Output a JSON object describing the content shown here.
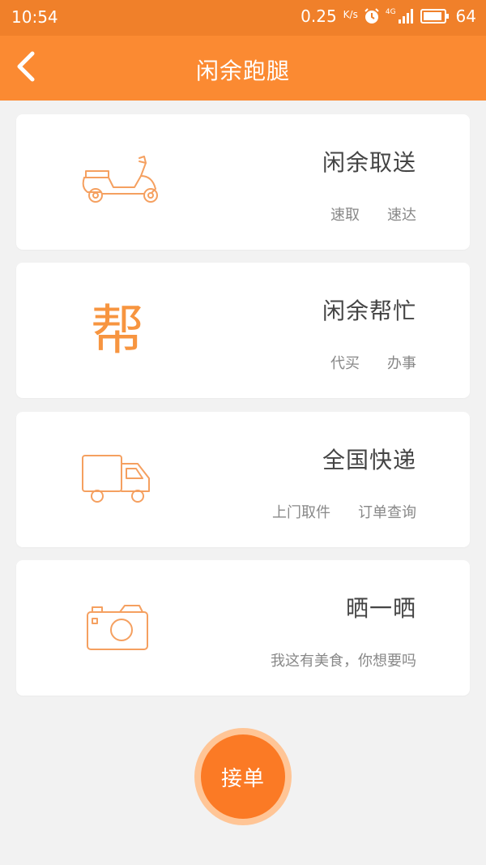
{
  "status_bar": {
    "time": "10:54",
    "net_speed": "0.25",
    "net_speed_unit": "K/s",
    "network": "4G",
    "battery": "64"
  },
  "app_bar": {
    "title": "闲余跑腿",
    "back_icon": "chevron-left-icon"
  },
  "cards": [
    {
      "title": "闲余取送",
      "icon": "scooter-icon",
      "subs": [
        "速取",
        "速达"
      ]
    },
    {
      "title": "闲余帮忙",
      "icon": "bang-glyph",
      "glyph": "帮",
      "subs": [
        "代买",
        "办事"
      ]
    },
    {
      "title": "全国快递",
      "icon": "truck-icon",
      "subs": [
        "上门取件",
        "订单查询"
      ]
    },
    {
      "title": "晒一晒",
      "icon": "camera-icon",
      "subs": [
        "我这有美食，你想要吗"
      ]
    }
  ],
  "accept_button": {
    "label": "接单"
  },
  "colors": {
    "accent": "#fb8a32",
    "status_bar": "#f0802a",
    "icon_orange": "#f5a060"
  }
}
